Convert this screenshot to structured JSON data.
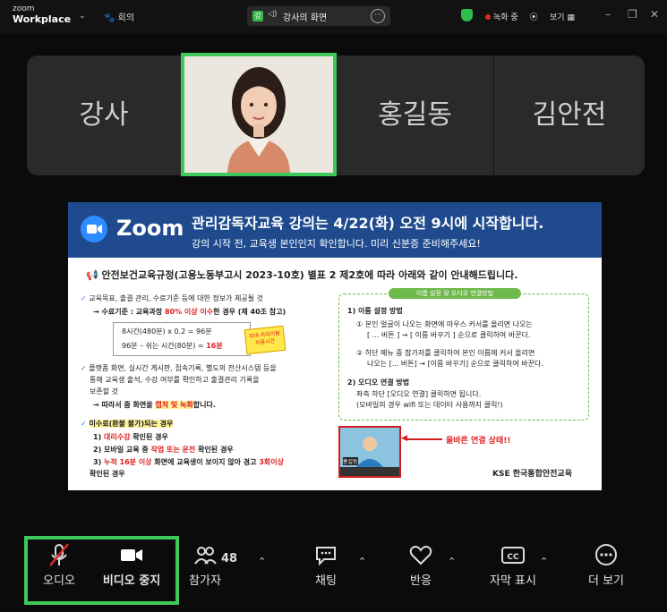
{
  "topbar": {
    "brand_top": "zoom",
    "brand_bottom": "Workplace",
    "meeting_label": "회의",
    "share_label": "강사의 화면",
    "share_badge": "강",
    "recording_label": "녹화 중",
    "view_label": "보기"
  },
  "gallery": {
    "tiles": [
      {
        "name": "강사"
      },
      {
        "name": "홍길동"
      },
      {
        "name": "김안전"
      }
    ]
  },
  "slide": {
    "brand": "Zoom",
    "banner_line1": "관리감독자교육 강의는 4/22(화) 오전 9시에 시작합니다.",
    "banner_line2": "강의 시작 전, 교육생 본인인지 확인합니다. 미리 신분증 준비해주세요!",
    "notice": "안전보건교육규정(고용노동부고시 2023-10호) 별표 2 제2호에 따라 아래와 같이 안내해드립니다.",
    "left": {
      "item1": "교육목표, 출결 관리, 수료기준 등에 대한 정보가 제공될 것",
      "criteria_a": "→ 수료기준 : 교육과정",
      "criteria_b": "80% 이상 이수",
      "criteria_c": "한 경우 (제 40조 참고)",
      "calc1": "8시간(480분) x 0.2 = 96분",
      "calc2a": "96분 – 쉬는 시간(80분) =",
      "calc2b": "16분",
      "burst": "최대 자리이탈 허용시간",
      "item2_line1": "플랫폼 화면, 실시간 게시판, 접속기록, 별도의 전산시스템 등을",
      "item2_line2": "통해 교육생 출석, 수강 여부를 확인하고 출결관리 기록을",
      "item2_line3": "보존할 것",
      "item2_line4a": "→ 따라서 줌 화면을",
      "item2_line4b": "캡쳐 및 녹화",
      "item2_line4c": "합니다.",
      "item3_title": "미수료(환불 불가)되는 경우",
      "item3_1a": "1)",
      "item3_1b": "대리수강",
      "item3_1c": "확인된 경우",
      "item3_2a": "2) 모바일 교육 중",
      "item3_2b": "작업 또는 운전",
      "item3_2c": "확인된 경우",
      "item3_3a": "3)",
      "item3_3b": "누적 16분 이상",
      "item3_3c": "화면에 교육생이 보이지 않아 경고",
      "item3_3d": "3회이상",
      "item3_3e": "확인된 경우"
    },
    "right": {
      "tag": "이름 설정 및 오디오 연결방법",
      "s1_title": "1) 이름 설정 방법",
      "s1_a1": "① 본인 얼굴이 나오는 화면에 마우스 커서를 올리면 나오는",
      "s1_a2": "[ ... 버튼 ] → [ 이름 바꾸기 ] 순으로 클릭하여 바꾼다.",
      "s1_b1": "② 하단 메뉴 중 참가자를 클릭하여 본인 이름에 커서 올리면",
      "s1_b2": "나오는 [... 버튼] → [이름 바꾸기] 순으로 클릭하여 바꾼다.",
      "s2_title": "2) 오디오 연결 방법",
      "s2_a": "좌측 하단 [오디오 연결] 클릭하면 됩니다.",
      "s2_b": "(모바일의 경우 wifi 또는 데이터 사용까지 클릭!)",
      "correct": "올바른 연결 상태!!",
      "preview_name": "홍길동",
      "logo": "KSE 한국통합안전교육"
    }
  },
  "toolbar": {
    "audio": "오디오",
    "video": "비디오 중지",
    "participants": "참가자",
    "participants_count": "48",
    "chat": "채팅",
    "react": "반응",
    "captions": "자막 표시",
    "more": "더 보기"
  },
  "colors": {
    "active_green": "#3ec85a",
    "slide_banner": "#1f4b8e",
    "zoom_blue": "#2d8cff",
    "alert_red": "#e02020"
  }
}
